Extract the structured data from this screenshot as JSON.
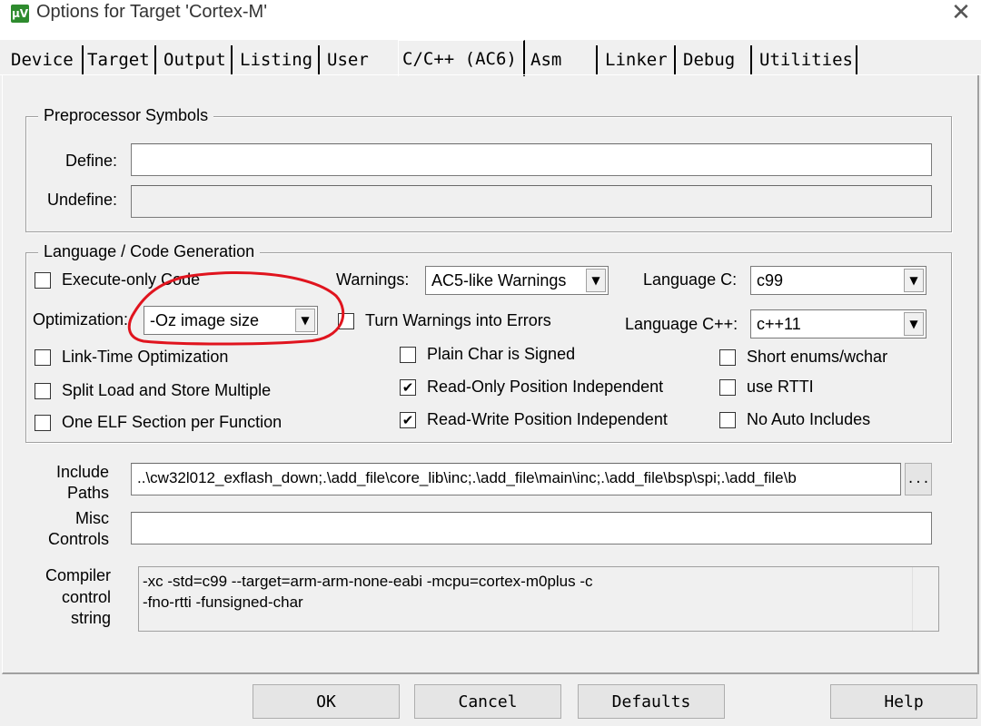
{
  "window": {
    "title": "Options for Target 'Cortex-M'",
    "app_icon_text": "μV",
    "close_glyph": "✕"
  },
  "tabs": [
    {
      "label": "Device"
    },
    {
      "label": "Target"
    },
    {
      "label": "Output"
    },
    {
      "label": "Listing"
    },
    {
      "label": "User"
    },
    {
      "label": "C/C++ (AC6)"
    },
    {
      "label": "Asm"
    },
    {
      "label": "Linker"
    },
    {
      "label": "Debug"
    },
    {
      "label": "Utilities"
    }
  ],
  "active_tab": "C/C++ (AC6)",
  "preprocessor": {
    "title": "Preprocessor Symbols",
    "define_label": "Define:",
    "define_value": "",
    "undefine_label": "Undefine:",
    "undefine_value": ""
  },
  "language": {
    "title": "Language / Code Generation",
    "execute_only_code": {
      "label": "Execute-only Code",
      "checked": false
    },
    "optimization_label": "Optimization:",
    "optimization_value": "-Oz image size",
    "warnings_label": "Warnings:",
    "warnings_value": "AC5-like Warnings",
    "turn_warnings_into_errors": {
      "label": "Turn Warnings into Errors",
      "checked": false
    },
    "language_c_label": "Language C:",
    "language_c_value": "c99",
    "language_cpp_label": "Language C++:",
    "language_cpp_value": "c++11",
    "link_time_optimization": {
      "label": "Link-Time Optimization",
      "checked": false
    },
    "split_load_store": {
      "label": "Split Load and Store Multiple",
      "checked": false
    },
    "one_elf_section": {
      "label": "One ELF Section per Function",
      "checked": false
    },
    "plain_char_signed": {
      "label": "Plain Char is Signed",
      "checked": false
    },
    "ropi": {
      "label": "Read-Only Position Independent",
      "checked": true
    },
    "rwpi": {
      "label": "Read-Write Position Independent",
      "checked": true
    },
    "short_enums": {
      "label": "Short enums/wchar",
      "checked": false
    },
    "use_rtti": {
      "label": "use RTTI",
      "checked": false
    },
    "no_auto_includes": {
      "label": "No Auto Includes",
      "checked": false
    },
    "check_glyph": "✔"
  },
  "include_paths": {
    "label_line1": "Include",
    "label_line2": "Paths",
    "value": "..\\cw32l012_exflash_down;.\\add_file\\core_lib\\inc;.\\add_file\\main\\inc;.\\add_file\\bsp\\spi;.\\add_file\\b",
    "browse_label": "..."
  },
  "misc_controls": {
    "label_line1": "Misc",
    "label_line2": "Controls",
    "value": ""
  },
  "compiler_control": {
    "label_line1": "Compiler",
    "label_line2": "control",
    "label_line3": "string",
    "value": "-xc -std=c99 --target=arm-arm-none-eabi -mcpu=cortex-m0plus -c\n-fno-rtti -funsigned-char"
  },
  "buttons": {
    "ok": "OK",
    "cancel": "Cancel",
    "defaults": "Defaults",
    "help": "Help"
  },
  "annotation": {
    "color": "#e0141e"
  },
  "combo_arrow": "▼"
}
